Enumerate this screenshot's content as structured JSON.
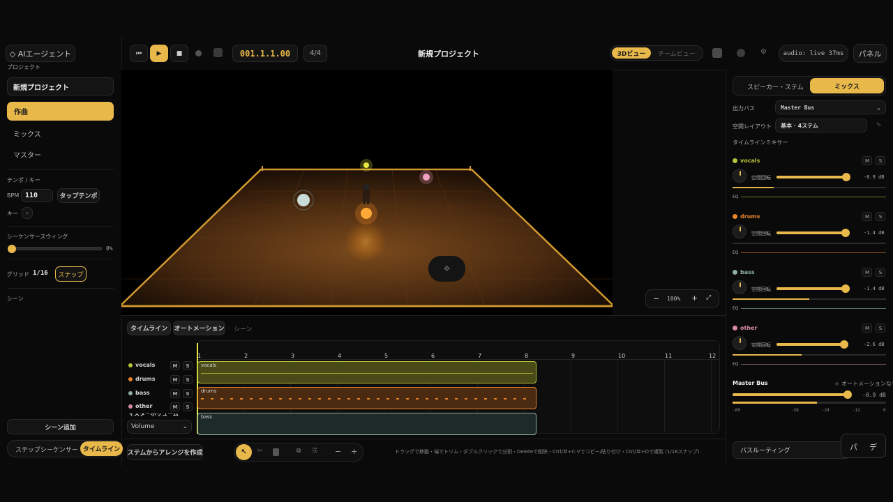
{
  "header": {
    "ai_agent": "◇ AIエージェント",
    "time": "001.1.1.00",
    "meter": "4/4",
    "project_title": "新規プロジェクト",
    "view_3d": "3Dビュー",
    "view_team": "チームビュー",
    "audio_status": "audio: live 37ms",
    "panel": "パネル"
  },
  "left": {
    "project_label": "プロジェクト",
    "project_name": "新規プロジェクト",
    "nav": [
      "作曲",
      "ミックス",
      "マスター"
    ],
    "tempo_key_label": "テンポ / キー",
    "bpm_label": "BPM",
    "bpm_value": "110",
    "tap_tempo": "タップテンポ",
    "key_label": "キー",
    "key_value": "-",
    "swing_label": "シーケンサースウィング",
    "swing_value": "0%",
    "grid_label": "グリッド",
    "grid_value": "1/16",
    "snap": "スナップ",
    "scene_label": "シーン",
    "add_scene": "シーン追加",
    "step_sequencer": "ステップシーケンサー",
    "timeline": "タイムライン"
  },
  "viewport": {
    "zoom": "100%"
  },
  "timeline": {
    "tabs": [
      "タイムライン",
      "オートメーション",
      "シーン"
    ],
    "ticks": [
      "1",
      "2",
      "3",
      "4",
      "5",
      "6",
      "7",
      "8",
      "9",
      "10",
      "11",
      "12"
    ],
    "tracks": [
      {
        "name": "vocals",
        "color": "#b8c43a"
      },
      {
        "name": "drums",
        "color": "#e8842a"
      },
      {
        "name": "bass",
        "color": "#8fb0a8"
      },
      {
        "name": "other",
        "color": "#d88aa8"
      }
    ],
    "master_volume_label": "マスターボリューム",
    "volume_select": "Volume",
    "clips": [
      "vocals",
      "drums",
      "bass"
    ],
    "mute": "M",
    "solo": "S"
  },
  "bottom": {
    "create_arrange": "ステムからアレンジを作成",
    "hint": "ドラッグで移動・端でトリム・ダブルクリックで分割・Deleteで削除・Ctrl/⌘+C·Vでコピー/貼り付け・Ctrl/⌘+Dで複製 (1/16スナップ)"
  },
  "right": {
    "tabs": [
      "スピーカー・ステム",
      "ミックス"
    ],
    "output_bus_label": "出力バス",
    "output_bus_value": "Master Bus",
    "layout_label": "空間レイアウト",
    "layout_value": "基本 · 4ステム",
    "mixer_title": "タイムラインミキサー",
    "knob_label": "空間回転",
    "eq_label": "EQ",
    "channels": [
      {
        "name": "vocals",
        "color": "#b8c43a",
        "db": "-0.9 dB",
        "level": 0.97,
        "meter": 0.27
      },
      {
        "name": "drums",
        "color": "#e8842a",
        "db": "-1.4 dB",
        "level": 0.96,
        "meter": 0.0
      },
      {
        "name": "bass",
        "color": "#8fb0a8",
        "db": "-1.4 dB",
        "level": 0.96,
        "meter": 0.5
      },
      {
        "name": "other",
        "color": "#d88aa8",
        "db": "-2.6 dB",
        "level": 0.94,
        "meter": 0.45
      }
    ],
    "master_bus": "Master Bus",
    "no_automation": "オートメーションなし",
    "master_db": "-0.9 dB",
    "master_level": 0.97,
    "master_meter": 0.55,
    "scale": [
      "-60",
      "-36",
      "-24",
      "-12",
      "0"
    ],
    "bus_routing": "バスルーティング",
    "float_buttons": [
      "パ",
      "デ"
    ]
  },
  "colors": {
    "accent": "#e8b84a"
  }
}
